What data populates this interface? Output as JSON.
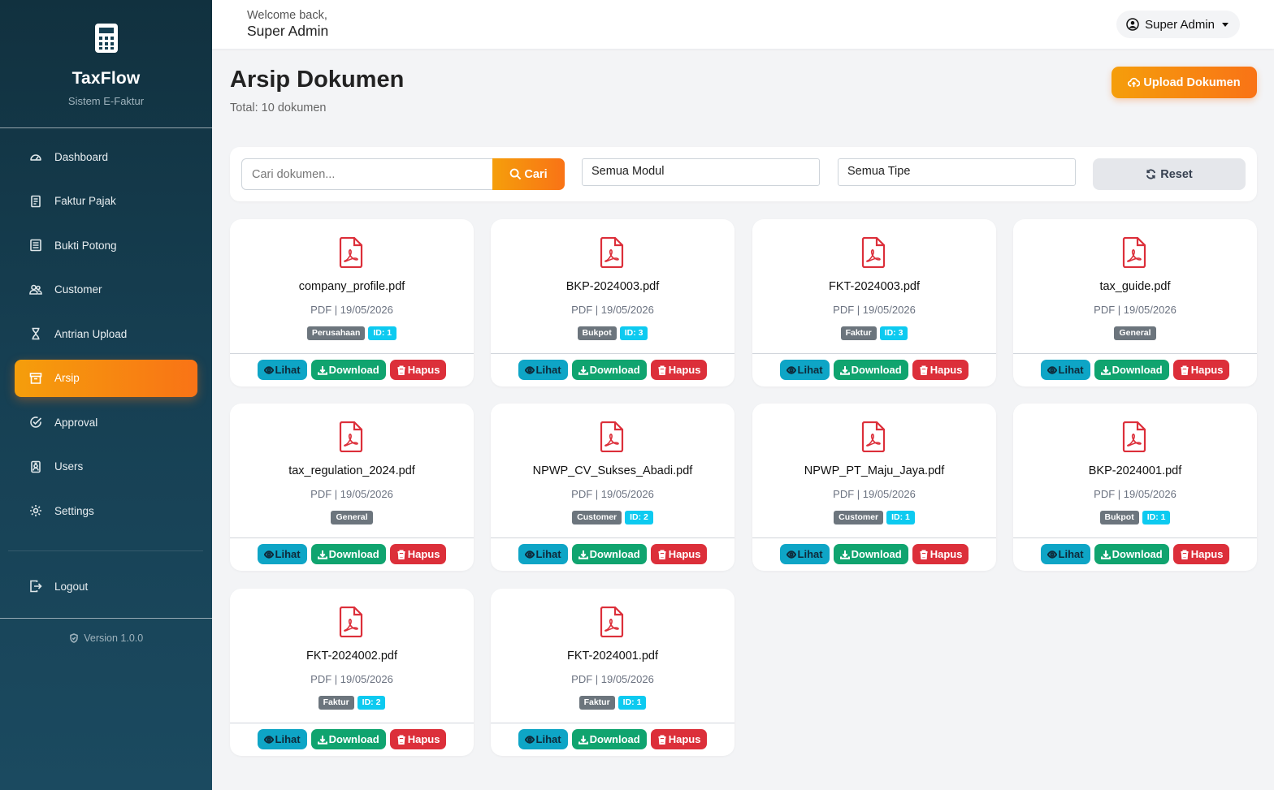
{
  "brand": {
    "title": "TaxFlow",
    "subtitle": "Sistem E-Faktur"
  },
  "nav": [
    {
      "label": "Dashboard",
      "icon": "speedometer-icon"
    },
    {
      "label": "Faktur Pajak",
      "icon": "document-icon"
    },
    {
      "label": "Bukti Potong",
      "icon": "receipt-icon"
    },
    {
      "label": "Customer",
      "icon": "people-icon"
    },
    {
      "label": "Antrian Upload",
      "icon": "hourglass-icon"
    },
    {
      "label": "Arsip",
      "icon": "archive-icon",
      "active": true
    },
    {
      "label": "Approval",
      "icon": "check-circle-icon"
    },
    {
      "label": "Users",
      "icon": "person-badge-icon"
    },
    {
      "label": "Settings",
      "icon": "gear-icon"
    }
  ],
  "logout": {
    "label": "Logout"
  },
  "version": "Version 1.0.0",
  "header": {
    "welcome": "Welcome back,",
    "name": "Super Admin",
    "user_button": "Super Admin"
  },
  "page": {
    "title": "Arsip Dokumen",
    "total": "Total: 10 dokumen",
    "upload_label": "Upload Dokumen"
  },
  "filter": {
    "search_placeholder": "Cari dokumen...",
    "search_value": "",
    "search_label": "Cari",
    "modul_selected": "Semua Modul",
    "tipe_selected": "Semua Tipe",
    "reset_label": "Reset"
  },
  "actions": {
    "view": "Lihat",
    "download": "Download",
    "delete": "Hapus"
  },
  "documents": [
    {
      "name": "company_profile.pdf",
      "meta": "PDF | 19/05/2026",
      "category": "Perusahaan",
      "id": "ID: 1"
    },
    {
      "name": "BKP-2024003.pdf",
      "meta": "PDF | 19/05/2026",
      "category": "Bukpot",
      "id": "ID: 3"
    },
    {
      "name": "FKT-2024003.pdf",
      "meta": "PDF | 19/05/2026",
      "category": "Faktur",
      "id": "ID: 3"
    },
    {
      "name": "tax_guide.pdf",
      "meta": "PDF | 19/05/2026",
      "category": "General",
      "id": ""
    },
    {
      "name": "tax_regulation_2024.pdf",
      "meta": "PDF | 19/05/2026",
      "category": "General",
      "id": ""
    },
    {
      "name": "NPWP_CV_Sukses_Abadi.pdf",
      "meta": "PDF | 19/05/2026",
      "category": "Customer",
      "id": "ID: 2"
    },
    {
      "name": "NPWP_PT_Maju_Jaya.pdf",
      "meta": "PDF | 19/05/2026",
      "category": "Customer",
      "id": "ID: 1"
    },
    {
      "name": "BKP-2024001.pdf",
      "meta": "PDF | 19/05/2026",
      "category": "Bukpot",
      "id": "ID: 1"
    },
    {
      "name": "FKT-2024002.pdf",
      "meta": "PDF | 19/05/2026",
      "category": "Faktur",
      "id": "ID: 2"
    },
    {
      "name": "FKT-2024001.pdf",
      "meta": "PDF | 19/05/2026",
      "category": "Faktur",
      "id": "ID: 1"
    }
  ],
  "colors": {
    "accent": "#f97316",
    "sidebar": "#163f52",
    "pdf_icon": "#dc2f3a",
    "view": "#0ea5c6",
    "download": "#10a46f",
    "delete": "#dc2f3a"
  }
}
